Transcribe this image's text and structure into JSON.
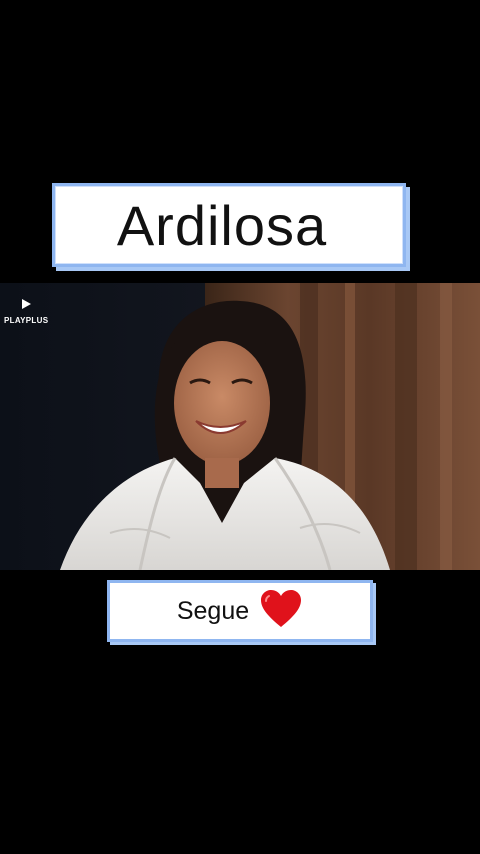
{
  "title": {
    "text": "Ardilosa"
  },
  "video": {
    "watermark": "PLAYPLUS",
    "description_icon": "play-logo-icon"
  },
  "follow_banner": {
    "text": "Segue",
    "icon": "heart-icon",
    "icon_color": "#e0121b"
  },
  "colors": {
    "background": "#000000",
    "box_border": "#8fb6f0"
  }
}
